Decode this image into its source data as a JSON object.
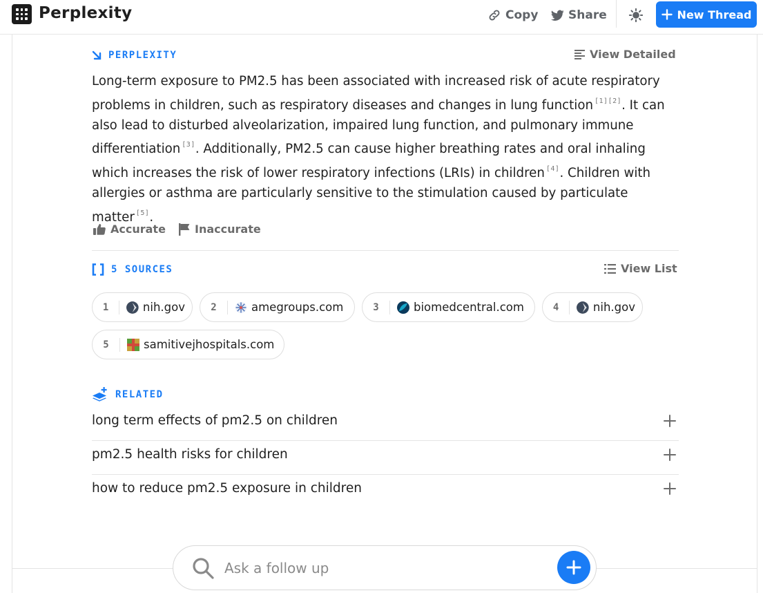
{
  "app": {
    "brand": "Perplexity"
  },
  "toolbar": {
    "copy_label": "Copy",
    "share_label": "Share",
    "new_thread_label": "New Thread"
  },
  "answer_section": {
    "label": "PERPLEXITY",
    "view_detailed_label": "View Detailed",
    "segments": [
      {
        "text": "Long-term exposure to PM2.5 has been associated with increased risk of acute respiratory problems in children, such as respiratory diseases and changes in lung function",
        "cites": "[1][2]"
      },
      {
        "text": ". It can also lead to disturbed alveolarization, impaired lung function, and pulmonary immune differentiation",
        "cites": "[3]"
      },
      {
        "text": ". Additionally, PM2.5 can cause higher breathing rates and oral inhaling which increases the risk of lower respiratory infections (LRIs) in children",
        "cites": "[4]"
      },
      {
        "text": ". Children with allergies or asthma are particularly sensitive to the stimulation caused by particulate matter",
        "cites": "[5]"
      },
      {
        "text": ".",
        "cites": ""
      }
    ],
    "accurate_label": "Accurate",
    "inaccurate_label": "Inaccurate"
  },
  "sources_section": {
    "label": "5 SOURCES",
    "view_list_label": "View List",
    "items": [
      {
        "num": "1",
        "domain": "nih.gov",
        "icon": "nih-favicon"
      },
      {
        "num": "2",
        "domain": "amegroups.com",
        "icon": "amegroups-favicon"
      },
      {
        "num": "3",
        "domain": "biomedcentral.com",
        "icon": "biomedcentral-favicon"
      },
      {
        "num": "4",
        "domain": "nih.gov",
        "icon": "nih-favicon"
      },
      {
        "num": "5",
        "domain": "samitivejhospitals.com",
        "icon": "samitivej-favicon"
      }
    ]
  },
  "related_section": {
    "label": "RELATED",
    "items": [
      {
        "text": "long term effects of pm2.5 on children"
      },
      {
        "text": "pm2.5 health risks for children"
      },
      {
        "text": "how to reduce pm2.5 exposure in children"
      }
    ]
  },
  "followup": {
    "placeholder": "Ask a follow up"
  },
  "colors": {
    "accent": "#1a7cf5",
    "text": "#1f1f1f",
    "muted": "#6b6b6b"
  }
}
